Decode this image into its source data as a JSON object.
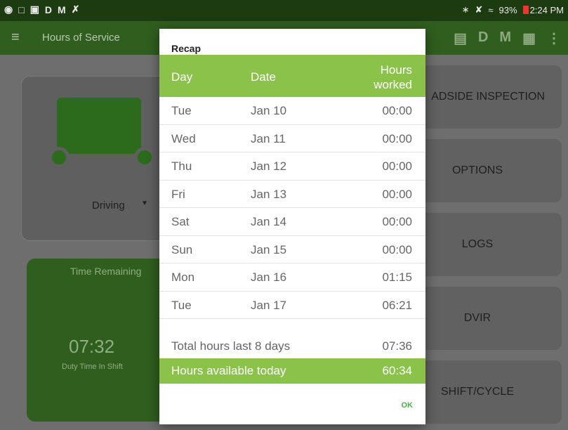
{
  "statusbar": {
    "left_icons": [
      "spotify-icon",
      "clipboard-icon",
      "image-icon",
      "D",
      "M",
      "tools-icon"
    ],
    "left_letters": [
      "D",
      "M"
    ],
    "battery": "93%",
    "time": "2:24 PM"
  },
  "appbar": {
    "title": "Hours of Service",
    "actions": [
      "message-icon",
      "D",
      "M",
      "export-icon",
      "more-icon"
    ],
    "action_d": "D",
    "action_m": "M"
  },
  "background": {
    "status_label": "Driving",
    "time_remaining_label": "Time Remaining",
    "time_remaining_value": "07:32",
    "duty_label": "Duty Time In Shift",
    "buttons": [
      "ROADSIDE INSPECTION",
      "OPTIONS",
      "LOGS",
      "DVIR",
      "SHIFT/CYCLE"
    ],
    "roadside_visible": "ADSIDE INSPECTION"
  },
  "dialog": {
    "title": "Recap",
    "columns": {
      "day": "Day",
      "date": "Date",
      "hours_line1": "Hours",
      "hours_line2": "worked"
    },
    "rows": [
      {
        "day": "Tue",
        "date": "Jan 10",
        "hours": "00:00"
      },
      {
        "day": "Wed",
        "date": "Jan 11",
        "hours": "00:00"
      },
      {
        "day": "Thu",
        "date": "Jan 12",
        "hours": "00:00"
      },
      {
        "day": "Fri",
        "date": "Jan 13",
        "hours": "00:00"
      },
      {
        "day": "Sat",
        "date": "Jan 14",
        "hours": "00:00"
      },
      {
        "day": "Sun",
        "date": "Jan 15",
        "hours": "00:00"
      },
      {
        "day": "Mon",
        "date": "Jan 16",
        "hours": "01:15"
      },
      {
        "day": "Tue",
        "date": "Jan 17",
        "hours": "06:21"
      }
    ],
    "total_label": "Total hours last 8 days",
    "total_value": "07:36",
    "available_label": "Hours available today",
    "available_value": "60:34",
    "ok_label": "OK"
  },
  "colors": {
    "accent_green": "#8bc34a",
    "ok_green": "#4caf50",
    "appbar": "#2f5e1f"
  }
}
